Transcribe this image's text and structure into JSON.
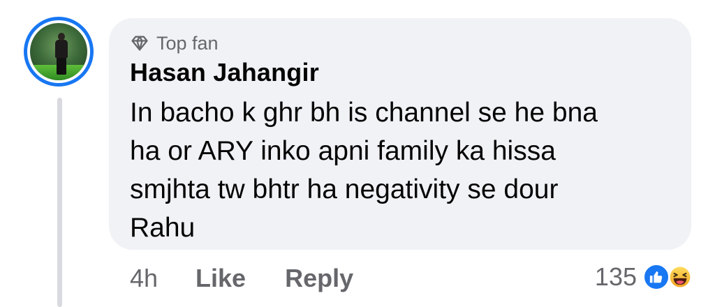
{
  "comment": {
    "badge_label": "Top fan",
    "author_name": "Hasan Jahangir",
    "text_lines": [
      "In bacho k ghr bh is channel se he bna",
      "ha or ARY inko apni family ka hissa",
      "smjhta tw bhtr ha negativity se dour",
      "Rahu"
    ],
    "timestamp": "4h",
    "like_label": "Like",
    "reply_label": "Reply",
    "reaction_count": "135"
  },
  "icons": {
    "badge": "diamond-icon",
    "reaction_1": "like-reaction-icon",
    "reaction_2": "haha-reaction-icon"
  },
  "colors": {
    "avatar_ring": "#1877f2",
    "bubble_bg": "#f0f2f5",
    "secondary_text": "#65676b",
    "primary_text": "#050505",
    "like_blue": "#1877f2",
    "haha_yellow": "#f7c22d"
  }
}
